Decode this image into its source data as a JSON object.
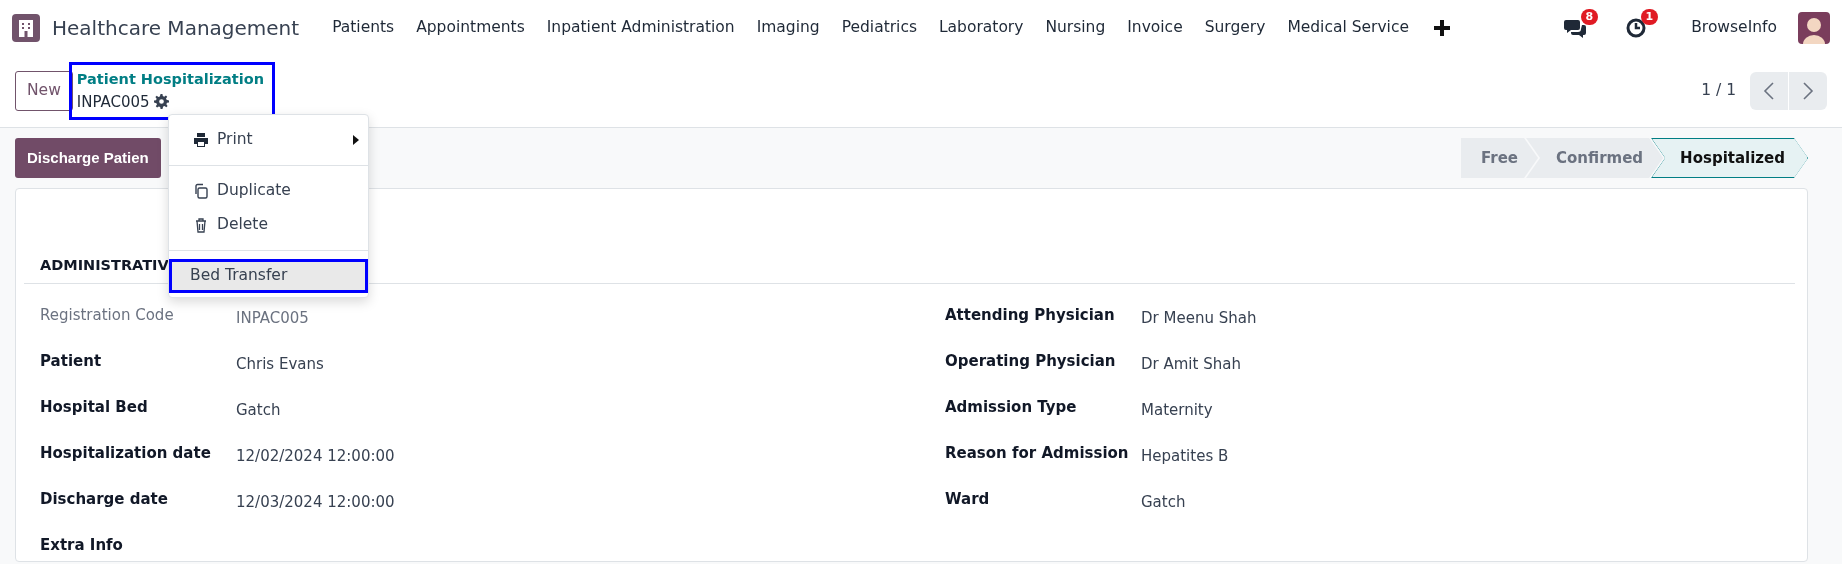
{
  "navbar": {
    "app_name": "Healthcare Management",
    "menu": [
      "Patients",
      "Appointments",
      "Inpatient Administration",
      "Imaging",
      "Pediatrics",
      "Laboratory",
      "Nursing",
      "Invoice",
      "Surgery",
      "Medical Service"
    ],
    "messages_badge": "8",
    "activities_badge": "1",
    "user": "BrowseInfo"
  },
  "control_panel": {
    "new_button": "New",
    "breadcrumb": {
      "parent": "Patient Hospitalization",
      "current": "INPAC005",
      "highlighted": true
    },
    "pager": "1 / 1"
  },
  "action_menu": {
    "sections": [
      [
        {
          "label": "Print",
          "submenu": true,
          "hovered": false,
          "highlighted": false
        }
      ],
      [
        {
          "label": "Duplicate",
          "submenu": false,
          "hovered": false,
          "highlighted": false
        },
        {
          "label": "Delete",
          "submenu": false,
          "hovered": false,
          "highlighted": false
        }
      ],
      [
        {
          "label": "Bed Transfer",
          "submenu": false,
          "hovered": true,
          "highlighted": true
        }
      ]
    ]
  },
  "header_button": "Discharge Patien",
  "statusbar": [
    {
      "label": "Free",
      "selected": false
    },
    {
      "label": "Confirmed",
      "selected": false
    },
    {
      "label": "Hospitalized",
      "selected": true
    }
  ],
  "form": {
    "section_title": "ADMINISTRATIV",
    "left_fields": [
      {
        "label": "Registration Code",
        "value": "INPAC005",
        "readonly": true
      },
      {
        "label": "Patient",
        "value": "Chris Evans",
        "readonly": false
      },
      {
        "label": "Hospital Bed",
        "value": "Gatch",
        "readonly": false
      },
      {
        "label": "Hospitalization date",
        "value": "12/02/2024 12:00:00",
        "readonly": false
      },
      {
        "label": "Discharge date",
        "value": "12/03/2024 12:00:00",
        "readonly": false
      },
      {
        "label": "Extra Info",
        "readonly": false
      }
    ],
    "right_fields": [
      {
        "label": "Attending Physician",
        "value": "Dr Meenu Shah",
        "readonly": false
      },
      {
        "label": "Operating Physician",
        "value": "Dr Amit Shah",
        "readonly": false
      },
      {
        "label": "Admission Type",
        "value": "Maternity",
        "readonly": false
      },
      {
        "label": "Reason for Admission",
        "value": "Hepatites B",
        "readonly": false
      },
      {
        "label": "Ward",
        "value": "Gatch",
        "readonly": false
      }
    ]
  }
}
